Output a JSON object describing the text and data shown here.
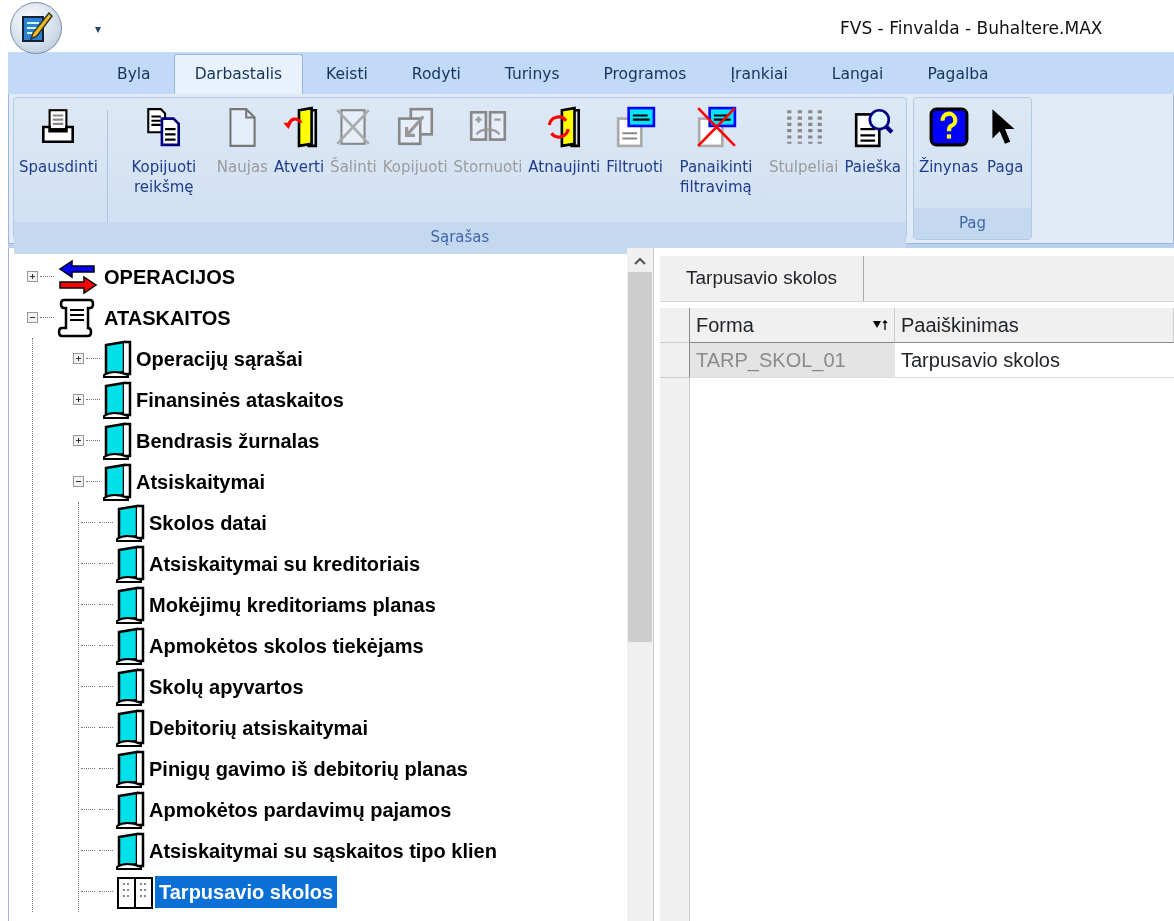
{
  "window": {
    "title": "FVS - Finvalda - Buhaltere.MAX",
    "quick_access": "▾"
  },
  "tabs": [
    {
      "label": "Byla",
      "selected": false
    },
    {
      "label": "Darbastalis",
      "selected": true
    },
    {
      "label": "Keisti",
      "selected": false
    },
    {
      "label": "Rodyti",
      "selected": false
    },
    {
      "label": "Turinys",
      "selected": false
    },
    {
      "label": "Programos",
      "selected": false
    },
    {
      "label": "Įrankiai",
      "selected": false
    },
    {
      "label": "Langai",
      "selected": false
    },
    {
      "label": "Pagalba",
      "selected": false
    }
  ],
  "ribbon": {
    "groups": [
      {
        "label": "Sąrašas",
        "buttons": [
          {
            "label": "Spausdinti",
            "kind": "print",
            "disabled": false,
            "separator_after": true
          },
          {
            "label": "Kopijuoti reikšmę",
            "kind": "copy-value",
            "disabled": false
          },
          {
            "label": "Naujas",
            "kind": "new",
            "disabled": true
          },
          {
            "label": "Atverti",
            "kind": "open",
            "disabled": false
          },
          {
            "label": "Šalinti",
            "kind": "delete",
            "disabled": true
          },
          {
            "label": "Kopijuoti",
            "kind": "copy",
            "disabled": true
          },
          {
            "label": "Stornuoti",
            "kind": "reverse",
            "disabled": true
          },
          {
            "label": "Atnaujinti",
            "kind": "refresh",
            "disabled": false
          },
          {
            "label": "Filtruoti",
            "kind": "filter",
            "disabled": false
          },
          {
            "label": "Panaikinti filtravimą",
            "kind": "clear-filter",
            "disabled": false
          },
          {
            "label": "Stulpeliai",
            "kind": "columns",
            "disabled": true
          },
          {
            "label": "Paieška",
            "kind": "search",
            "disabled": false
          }
        ]
      },
      {
        "label": "Pag",
        "buttons": [
          {
            "label": "Žinynas",
            "kind": "help",
            "disabled": false
          },
          {
            "label": "Paga",
            "kind": "pointer-help",
            "disabled": false
          }
        ]
      }
    ]
  },
  "tree": [
    {
      "label": "OPERACIJOS",
      "kind": "arrows",
      "expanded": false,
      "selected": false
    },
    {
      "label": "ATASKAITOS",
      "kind": "scroll",
      "expanded": true,
      "selected": false,
      "children": [
        {
          "label": "Operacijų sąrašai",
          "kind": "book",
          "expanded": false,
          "selected": false
        },
        {
          "label": "Finansinės ataskaitos",
          "kind": "book",
          "expanded": false,
          "selected": false
        },
        {
          "label": "Bendrasis žurnalas",
          "kind": "book",
          "expanded": false,
          "selected": false
        },
        {
          "label": "Atsiskaitymai",
          "kind": "book",
          "expanded": true,
          "selected": false,
          "children": [
            {
              "label": "Skolos datai",
              "kind": "book",
              "selected": false
            },
            {
              "label": "Atsiskaitymai su kreditoriais",
              "kind": "book",
              "selected": false
            },
            {
              "label": "Mokėjimų kreditoriams planas",
              "kind": "book",
              "selected": false
            },
            {
              "label": "Apmokėtos skolos tiekėjams",
              "kind": "book",
              "selected": false
            },
            {
              "label": "Skolų apyvartos",
              "kind": "book",
              "selected": false
            },
            {
              "label": "Debitorių atsiskaitymai",
              "kind": "book",
              "selected": false
            },
            {
              "label": "Pinigų gavimo iš debitorių planas",
              "kind": "book",
              "selected": false
            },
            {
              "label": "Apmokėtos pardavimų pajamos",
              "kind": "book",
              "selected": false
            },
            {
              "label": "Atsiskaitymai su sąskaitos tipo klien",
              "kind": "book",
              "selected": false
            },
            {
              "label": "Tarpusavio skolos",
              "kind": "book-open",
              "selected": true
            }
          ]
        }
      ]
    }
  ],
  "grid": {
    "group_header": "Tarpusavio skolos",
    "columns": [
      {
        "label": "Forma",
        "sorted": true
      },
      {
        "label": "Paaiškinimas",
        "sorted": false
      }
    ],
    "rows": [
      {
        "cells": [
          "TARP_SKOL_01",
          "Tarpusavio skolos"
        ],
        "selected": true
      }
    ]
  }
}
